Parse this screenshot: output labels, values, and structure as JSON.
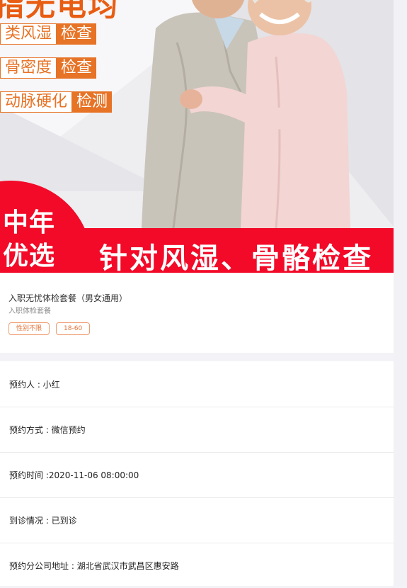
{
  "banner": {
    "headline_cut": "指无电均",
    "tags": [
      {
        "light": "类风湿",
        "dark": "检查"
      },
      {
        "light": "骨密度",
        "dark": "检查"
      },
      {
        "light": "动脉硬化",
        "dark": "检测"
      }
    ],
    "circle_line1": "中年",
    "circle_line2": "优选",
    "band_text": "针对风湿、骨骼检查",
    "colors": {
      "accent_orange": "#e77326",
      "promo_red": "#f20a28"
    }
  },
  "package": {
    "title": "入职无忧体检套餐（男女通用）",
    "subtitle": "入职体检套餐",
    "chips": [
      "性别不限",
      "18-60"
    ]
  },
  "details": [
    "预约人 : 小红",
    "预约方式 : 微信预约",
    "预约时间 :2020-11-06 08:00:00",
    "到诊情况 : 已到诊",
    "预约分公司地址 : 湖北省武汉市武昌区惠安路"
  ]
}
